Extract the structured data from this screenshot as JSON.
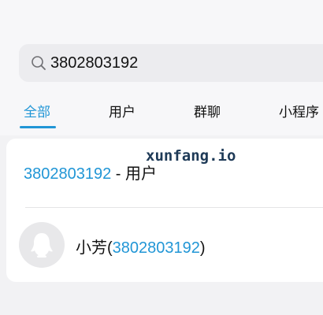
{
  "search": {
    "value": "3802803192"
  },
  "tabs": [
    {
      "label": "全部"
    },
    {
      "label": "用户"
    },
    {
      "label": "群聊"
    },
    {
      "label": "小程序"
    }
  ],
  "results": {
    "user_row": {
      "number": "3802803192",
      "separator": " - ",
      "type": "用户"
    },
    "contact": {
      "name": "小芳",
      "open_paren": "(",
      "number": "3802803192",
      "close_paren": ")"
    }
  },
  "watermark": "xunfang.io",
  "colors": {
    "accent": "#2196d6",
    "background": "#f2f2f4",
    "card": "#ffffff"
  }
}
